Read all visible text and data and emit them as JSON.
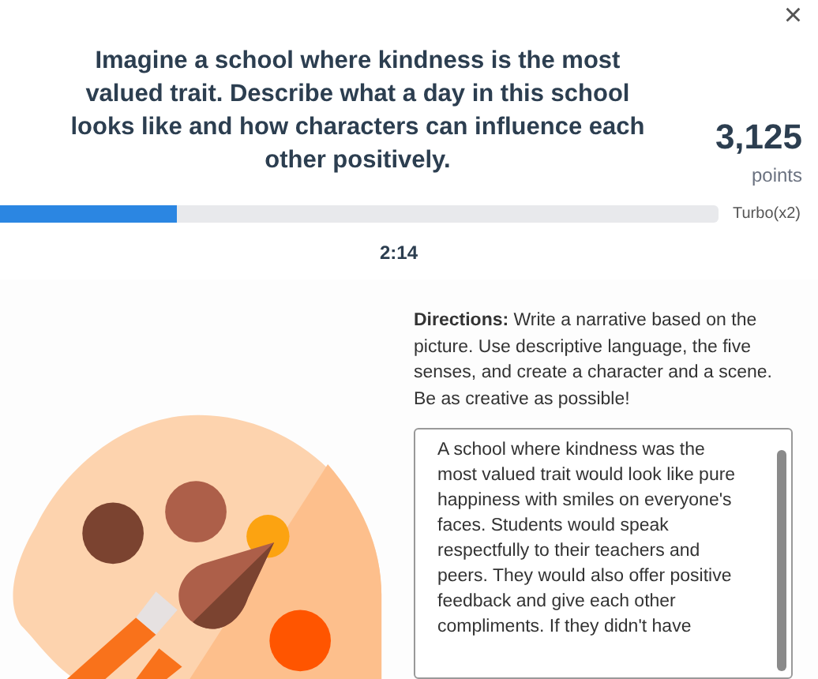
{
  "prompt": "Imagine a school where kindness is the most valued trait. Describe what a day in this school looks like and how characters can influence each other positively.",
  "close": "×",
  "score": {
    "value": "3,125",
    "unit": "points"
  },
  "progress": {
    "level": 0.246,
    "label": "Turbo(x2)"
  },
  "timer": "2:14",
  "directions": "**Directions:** Write a narrative based on the picture. Use descriptive language, the five senses, and create a character and a scene. Be as creative as possible!",
  "answer": {
    "value": "A school where kindness was the most valued trait would look like pure happiness with smiles on everyone's faces. Students would speak respectfully to their teachers and peers. They would also offer positive feedback and give each other compliments. If they didn't have"
  }
}
